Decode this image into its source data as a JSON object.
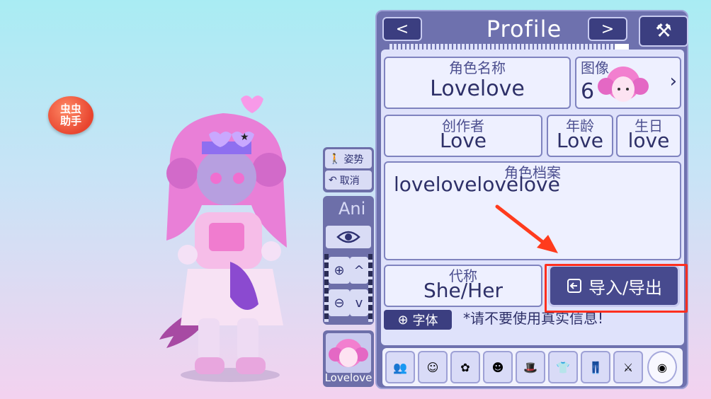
{
  "assistant": {
    "line1": "虫虫",
    "line2": "助手"
  },
  "side_tools": {
    "pose_label": "姿势",
    "undo_label": "取消",
    "anim_label": "Ani",
    "thumb_label": "Lovelove"
  },
  "profile": {
    "title": "Profile",
    "nav_prev": "<",
    "nav_next": ">",
    "progress": 0.06,
    "fields": {
      "name": {
        "label": "角色名称",
        "value": "Lovelove"
      },
      "icon": {
        "label": "图像",
        "value": "6"
      },
      "creator": {
        "label": "创作者",
        "value": "Love"
      },
      "age": {
        "label": "年龄",
        "value": "Love"
      },
      "birthday": {
        "label": "生日",
        "value": "love"
      },
      "bio": {
        "label": "角色档案",
        "value": "lovelovelovelove"
      },
      "pronouns": {
        "label": "代称",
        "value": "She/Her"
      }
    },
    "import_export_label": "导入/导出",
    "language_label": "字体",
    "disclaimer": "*请不要使用真实信息!"
  },
  "tabs": [
    "preset",
    "body",
    "hair",
    "face",
    "accessory",
    "top",
    "bottom",
    "weapon",
    "profile"
  ],
  "colors": {
    "panel": "#6e71ae",
    "highlight": "#ff2f1f",
    "arrow": "#ff3b1d"
  }
}
